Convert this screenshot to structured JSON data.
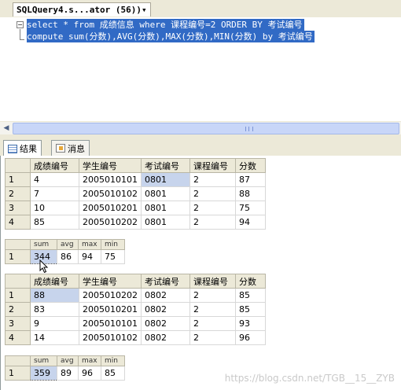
{
  "document_tab": {
    "title": "SQLQuery4.s...ator (56))▾"
  },
  "editor": {
    "lines": [
      "select * from 成绩信息 where 课程编号=2 ORDER BY 考试编号",
      "compute sum(分数),AVG(分数),MAX(分数),MIN(分数) by 考试编号"
    ],
    "collapse_glyph": "−"
  },
  "hscroll": {
    "left_arrow": "◀"
  },
  "result_tabs": {
    "results_label": "结果",
    "messages_label": "消息"
  },
  "grid_columns": [
    "成绩编号",
    "学生编号",
    "考试编号",
    "课程编号",
    "分数"
  ],
  "summary_columns": [
    "sum",
    "avg",
    "max",
    "min"
  ],
  "grid1": {
    "rows": [
      {
        "n": "1",
        "c": [
          "4",
          "2005010101",
          "0801",
          "2",
          "87"
        ]
      },
      {
        "n": "2",
        "c": [
          "7",
          "2005010102",
          "0801",
          "2",
          "88"
        ]
      },
      {
        "n": "3",
        "c": [
          "10",
          "2005010201",
          "0801",
          "2",
          "75"
        ]
      },
      {
        "n": "4",
        "c": [
          "85",
          "2005010202",
          "0801",
          "2",
          "94"
        ]
      }
    ]
  },
  "summary1": {
    "n": "1",
    "c": [
      "344",
      "86",
      "94",
      "75"
    ]
  },
  "grid2": {
    "rows": [
      {
        "n": "1",
        "c": [
          "88",
          "2005010202",
          "0802",
          "2",
          "85"
        ]
      },
      {
        "n": "2",
        "c": [
          "83",
          "2005010201",
          "0802",
          "2",
          "85"
        ]
      },
      {
        "n": "3",
        "c": [
          "9",
          "2005010101",
          "0802",
          "2",
          "93"
        ]
      },
      {
        "n": "4",
        "c": [
          "14",
          "2005010102",
          "0802",
          "2",
          "96"
        ]
      }
    ]
  },
  "summary2": {
    "n": "1",
    "c": [
      "359",
      "89",
      "96",
      "85"
    ]
  },
  "watermark": "https://blog.csdn.net/TGB__15__ZYB"
}
